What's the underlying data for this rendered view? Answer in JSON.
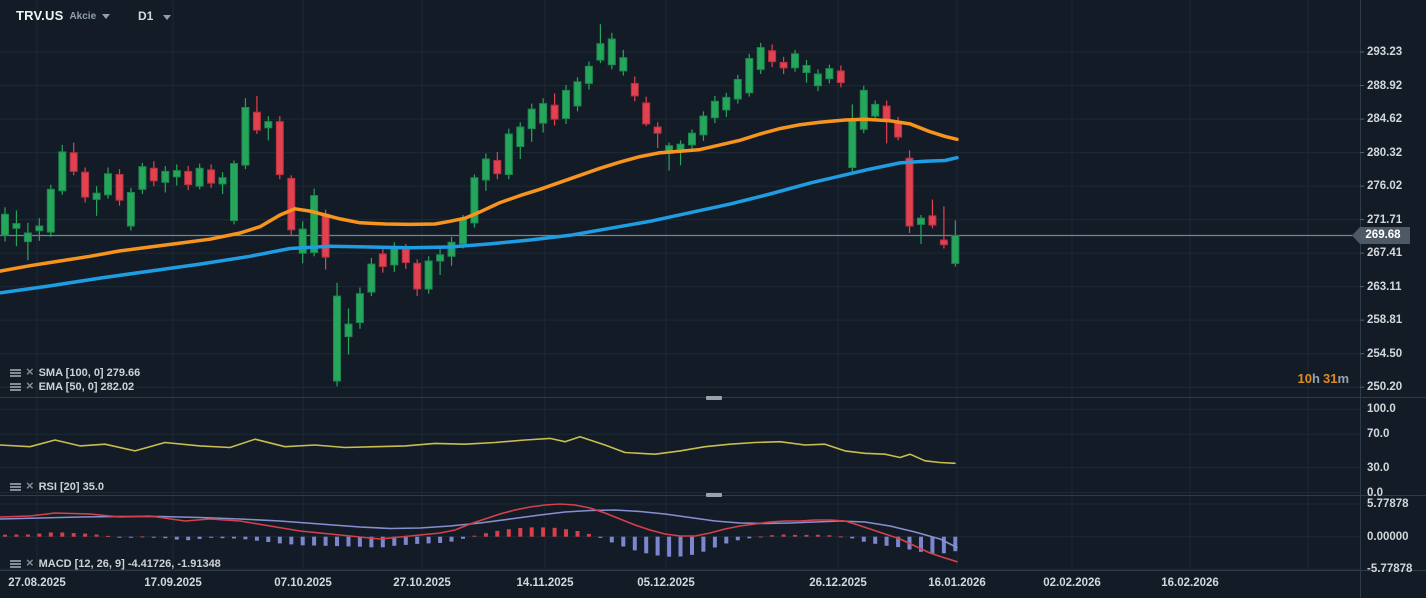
{
  "toolbar": {
    "symbol": "TRV.US",
    "instrument_type": "Akcie",
    "timeframe": "D1"
  },
  "timer": {
    "h_num": "10",
    "h_unit": "h",
    "m_num": "31",
    "m_unit": "m"
  },
  "indicators": {
    "sma": {
      "text": "SMA [100, 0] 279.66"
    },
    "ema": {
      "text": "EMA [50, 0] 282.02"
    },
    "rsi": {
      "text": "RSI [20]  35.0"
    },
    "macd": {
      "text": "MACD [12, 26, 9] -4.41726,  -1.91348"
    }
  },
  "axis": {
    "price_labels": [
      "293.23",
      "288.92",
      "284.62",
      "280.32",
      "276.02",
      "271.71",
      "267.41",
      "263.11",
      "258.81",
      "254.50",
      "250.20"
    ],
    "current_price": "269.68",
    "rsi_labels": [
      {
        "v": 100,
        "text": "100.0"
      },
      {
        "v": 70,
        "text": "70.0"
      },
      {
        "v": 30,
        "text": "30.0"
      },
      {
        "v": 0,
        "text": "0.0"
      }
    ],
    "macd_labels": [
      {
        "v": 5.77878,
        "text": "5.77878"
      },
      {
        "v": 0,
        "text": "0.00000"
      },
      {
        "v": -5.77878,
        "text": "-5.77878"
      }
    ],
    "dates": [
      "27.08.2025",
      "17.09.2025",
      "07.10.2025",
      "27.10.2025",
      "14.11.2025",
      "05.12.2025",
      "26.12.2025",
      "16.01.2026",
      "02.02.2026",
      "16.02.2026"
    ]
  },
  "colors": {
    "background": "#131c26",
    "grid": "#1d2935",
    "separator": "#2e3b48",
    "bull": "#26a65b",
    "bull_stroke": "#1b8a4f",
    "bear": "#e2414f",
    "bear_stroke": "#b5323f",
    "ema_line": "#f7941d",
    "sma_line": "#1e9de3",
    "rsi_line": "#c8bd4f",
    "macd_line": "#d6404b",
    "macd_signal": "#8690d0",
    "hist_pos": "#d6404b",
    "hist_neg": "#7b86cf",
    "price_line": "#76828c",
    "tag_bg": "#4d5a66",
    "timer_accent": "#e08a1e"
  },
  "chart_data": {
    "type": "candlestick+indicators",
    "symbol": "TRV.US",
    "timeframe": "D1",
    "current_price": 269.68,
    "panes": [
      {
        "name": "price",
        "range": [
          250.2,
          293.23
        ]
      },
      {
        "name": "rsi",
        "range": [
          0,
          100
        ],
        "gridlines": [
          100,
          70,
          30,
          0
        ]
      },
      {
        "name": "macd",
        "range": [
          -5.77878,
          5.77878
        ]
      }
    ],
    "overlays": [
      {
        "name": "EMA",
        "params": [
          50,
          0
        ],
        "value": 282.02
      },
      {
        "name": "SMA",
        "params": [
          100,
          0
        ],
        "value": 279.66
      }
    ],
    "candles_ohlc": [
      [
        269.7,
        273.3,
        268.9,
        272.4
      ],
      [
        270.6,
        272.9,
        268.3,
        271.2
      ],
      [
        268.9,
        271.3,
        266.5,
        270.0
      ],
      [
        270.3,
        271.9,
        269.0,
        270.9
      ],
      [
        270.1,
        276.2,
        269.5,
        275.6
      ],
      [
        275.4,
        281.3,
        274.9,
        280.4
      ],
      [
        280.3,
        281.6,
        277.4,
        277.9
      ],
      [
        277.8,
        278.4,
        273.9,
        274.6
      ],
      [
        274.3,
        276.0,
        272.2,
        275.1
      ],
      [
        274.9,
        278.4,
        274.4,
        277.6
      ],
      [
        277.5,
        278.2,
        273.5,
        274.2
      ],
      [
        270.9,
        275.8,
        270.3,
        275.2
      ],
      [
        275.6,
        279.0,
        275.0,
        278.5
      ],
      [
        278.3,
        279.2,
        276.0,
        276.7
      ],
      [
        276.5,
        278.6,
        275.2,
        277.9
      ],
      [
        277.2,
        278.8,
        276.1,
        278.0
      ],
      [
        277.9,
        278.6,
        275.5,
        276.2
      ],
      [
        276.0,
        278.9,
        275.6,
        278.3
      ],
      [
        278.1,
        278.8,
        275.8,
        276.4
      ],
      [
        276.3,
        277.8,
        275.0,
        277.1
      ],
      [
        271.6,
        279.3,
        271.1,
        278.9
      ],
      [
        278.7,
        287.3,
        278.2,
        286.1
      ],
      [
        285.5,
        287.6,
        282.7,
        283.2
      ],
      [
        283.5,
        285.0,
        281.9,
        284.3
      ],
      [
        284.3,
        285.0,
        276.9,
        277.5
      ],
      [
        277.0,
        277.4,
        269.6,
        270.4
      ],
      [
        267.4,
        271.5,
        266.1,
        270.5
      ],
      [
        267.5,
        275.7,
        267.0,
        274.8
      ],
      [
        272.4,
        273.0,
        265.3,
        266.9
      ],
      [
        251.0,
        263.6,
        250.3,
        261.9
      ],
      [
        256.7,
        260.3,
        254.4,
        258.3
      ],
      [
        258.5,
        263.0,
        257.7,
        262.2
      ],
      [
        262.4,
        266.8,
        261.9,
        266.0
      ],
      [
        267.3,
        268.2,
        264.9,
        265.7
      ],
      [
        265.9,
        268.8,
        265.0,
        268.0
      ],
      [
        267.9,
        268.6,
        265.4,
        266.2
      ],
      [
        266.1,
        266.6,
        261.9,
        262.8
      ],
      [
        262.8,
        267.0,
        262.2,
        266.4
      ],
      [
        266.4,
        268.0,
        264.6,
        267.2
      ],
      [
        267.0,
        269.5,
        265.8,
        268.8
      ],
      [
        268.6,
        272.3,
        268.0,
        271.9
      ],
      [
        271.3,
        277.5,
        270.7,
        277.1
      ],
      [
        276.8,
        280.2,
        275.4,
        279.5
      ],
      [
        279.3,
        280.4,
        276.9,
        277.6
      ],
      [
        277.5,
        283.4,
        276.9,
        282.7
      ],
      [
        281.1,
        284.2,
        279.5,
        283.6
      ],
      [
        283.4,
        286.6,
        281.7,
        285.9
      ],
      [
        284.1,
        287.3,
        282.9,
        286.6
      ],
      [
        286.4,
        287.9,
        283.8,
        284.6
      ],
      [
        284.7,
        289.0,
        284.0,
        288.3
      ],
      [
        286.3,
        290.0,
        285.6,
        289.4
      ],
      [
        289.2,
        292.0,
        288.4,
        291.4
      ],
      [
        292.2,
        296.8,
        291.8,
        294.3
      ],
      [
        291.6,
        295.7,
        291.0,
        294.9
      ],
      [
        290.8,
        293.5,
        290.2,
        292.5
      ],
      [
        289.2,
        290.1,
        286.9,
        287.6
      ],
      [
        286.7,
        287.5,
        283.7,
        284.0
      ],
      [
        283.6,
        284.2,
        280.9,
        282.8
      ],
      [
        280.2,
        281.6,
        278.0,
        281.2
      ],
      [
        280.7,
        281.9,
        278.7,
        281.4
      ],
      [
        281.3,
        283.3,
        280.5,
        282.8
      ],
      [
        282.6,
        285.6,
        281.8,
        285.0
      ],
      [
        284.8,
        287.6,
        284.1,
        286.9
      ],
      [
        285.8,
        288.0,
        284.9,
        287.4
      ],
      [
        287.2,
        290.3,
        286.6,
        289.7
      ],
      [
        288.0,
        293.0,
        287.5,
        292.4
      ],
      [
        291.0,
        294.4,
        290.4,
        293.8
      ],
      [
        293.4,
        294.2,
        291.3,
        292.0
      ],
      [
        291.9,
        292.6,
        290.4,
        291.2
      ],
      [
        291.2,
        293.5,
        290.7,
        293.0
      ],
      [
        290.6,
        292.2,
        289.3,
        291.5
      ],
      [
        288.9,
        291.0,
        288.2,
        290.4
      ],
      [
        289.8,
        291.6,
        289.2,
        291.1
      ],
      [
        290.8,
        291.5,
        288.7,
        289.3
      ],
      [
        278.4,
        286.5,
        277.9,
        284.6
      ],
      [
        283.3,
        288.9,
        282.8,
        288.3
      ],
      [
        285.0,
        287.0,
        284.4,
        286.5
      ],
      [
        286.3,
        287.0,
        281.5,
        284.4
      ],
      [
        284.2,
        284.9,
        281.9,
        282.3
      ],
      [
        279.6,
        280.6,
        270.0,
        270.9
      ],
      [
        271.1,
        272.3,
        268.6,
        271.9
      ],
      [
        272.2,
        274.3,
        270.6,
        271.0
      ],
      [
        269.1,
        273.4,
        268.0,
        268.5
      ],
      [
        266.1,
        271.6,
        265.7,
        269.68
      ]
    ],
    "ema50": [
      [
        0,
        265.1
      ],
      [
        30,
        265.8
      ],
      [
        60,
        266.4
      ],
      [
        90,
        267.0
      ],
      [
        120,
        267.7
      ],
      [
        150,
        268.2
      ],
      [
        180,
        268.7
      ],
      [
        210,
        269.2
      ],
      [
        240,
        270.0
      ],
      [
        260,
        270.8
      ],
      [
        280,
        272.3
      ],
      [
        295,
        273.1
      ],
      [
        310,
        272.8
      ],
      [
        325,
        272.3
      ],
      [
        340,
        271.8
      ],
      [
        360,
        271.3
      ],
      [
        385,
        271.15
      ],
      [
        410,
        271.1
      ],
      [
        435,
        271.15
      ],
      [
        450,
        271.5
      ],
      [
        465,
        271.9
      ],
      [
        480,
        272.7
      ],
      [
        500,
        273.9
      ],
      [
        520,
        274.8
      ],
      [
        540,
        275.6
      ],
      [
        560,
        276.5
      ],
      [
        580,
        277.4
      ],
      [
        600,
        278.3
      ],
      [
        620,
        279.1
      ],
      [
        640,
        279.8
      ],
      [
        660,
        280.3
      ],
      [
        680,
        280.5
      ],
      [
        700,
        280.7
      ],
      [
        720,
        281.3
      ],
      [
        740,
        281.9
      ],
      [
        760,
        282.7
      ],
      [
        780,
        283.4
      ],
      [
        800,
        283.9
      ],
      [
        820,
        284.2
      ],
      [
        845,
        284.5
      ],
      [
        865,
        284.6
      ],
      [
        890,
        284.4
      ],
      [
        910,
        284.0
      ],
      [
        930,
        283.0
      ],
      [
        945,
        282.4
      ],
      [
        957,
        282.02
      ]
    ],
    "sma100": [
      [
        0,
        262.3
      ],
      [
        50,
        263.2
      ],
      [
        100,
        264.2
      ],
      [
        150,
        265.1
      ],
      [
        200,
        266.0
      ],
      [
        250,
        267.0
      ],
      [
        290,
        268.0
      ],
      [
        330,
        268.3
      ],
      [
        370,
        268.2
      ],
      [
        410,
        268.1
      ],
      [
        450,
        268.2
      ],
      [
        490,
        268.6
      ],
      [
        530,
        269.1
      ],
      [
        570,
        269.7
      ],
      [
        610,
        270.6
      ],
      [
        650,
        271.5
      ],
      [
        690,
        272.6
      ],
      [
        730,
        273.7
      ],
      [
        770,
        275.0
      ],
      [
        810,
        276.4
      ],
      [
        840,
        277.3
      ],
      [
        870,
        278.2
      ],
      [
        900,
        279.0
      ],
      [
        925,
        279.2
      ],
      [
        945,
        279.3
      ],
      [
        957,
        279.66
      ]
    ],
    "rsi": {
      "period": 20,
      "last": 35.0,
      "points": [
        [
          0,
          57
        ],
        [
          30,
          55
        ],
        [
          55,
          63
        ],
        [
          80,
          56
        ],
        [
          105,
          58
        ],
        [
          135,
          50
        ],
        [
          165,
          60
        ],
        [
          200,
          56
        ],
        [
          230,
          54
        ],
        [
          255,
          64
        ],
        [
          285,
          55
        ],
        [
          315,
          57
        ],
        [
          345,
          54
        ],
        [
          375,
          55
        ],
        [
          405,
          56
        ],
        [
          435,
          59
        ],
        [
          465,
          58
        ],
        [
          495,
          60
        ],
        [
          525,
          63
        ],
        [
          550,
          65
        ],
        [
          565,
          61
        ],
        [
          580,
          67
        ],
        [
          605,
          57
        ],
        [
          625,
          48
        ],
        [
          655,
          46
        ],
        [
          680,
          50
        ],
        [
          705,
          55
        ],
        [
          730,
          58
        ],
        [
          755,
          60
        ],
        [
          780,
          61
        ],
        [
          805,
          57
        ],
        [
          825,
          58
        ],
        [
          845,
          50
        ],
        [
          865,
          47
        ],
        [
          885,
          46
        ],
        [
          900,
          42
        ],
        [
          910,
          46
        ],
        [
          925,
          38
        ],
        [
          940,
          36
        ],
        [
          955,
          35
        ]
      ]
    },
    "macd": {
      "params": [
        12,
        26,
        9
      ],
      "last_macd": -4.41726,
      "last_signal": -1.91348,
      "macd_points": [
        [
          0,
          3.48
        ],
        [
          30,
          3.66
        ],
        [
          55,
          4.19
        ],
        [
          90,
          4.01
        ],
        [
          120,
          3.48
        ],
        [
          150,
          3.66
        ],
        [
          185,
          2.78
        ],
        [
          210,
          3.13
        ],
        [
          240,
          2.78
        ],
        [
          270,
          1.89
        ],
        [
          300,
          1.01
        ],
        [
          330,
          0.48
        ],
        [
          360,
          -0.05
        ],
        [
          380,
          -0.41
        ],
        [
          400,
          -0.05
        ],
        [
          420,
          0.3
        ],
        [
          440,
          0.65
        ],
        [
          455,
          1.18
        ],
        [
          470,
          2.24
        ],
        [
          485,
          3.13
        ],
        [
          500,
          4.01
        ],
        [
          515,
          4.72
        ],
        [
          530,
          5.25
        ],
        [
          545,
          5.6
        ],
        [
          560,
          5.78
        ],
        [
          575,
          5.6
        ],
        [
          590,
          5.07
        ],
        [
          605,
          4.19
        ],
        [
          620,
          3.13
        ],
        [
          635,
          2.07
        ],
        [
          650,
          1.18
        ],
        [
          665,
          0.48
        ],
        [
          680,
          0.12
        ],
        [
          695,
          0.12
        ],
        [
          710,
          0.65
        ],
        [
          725,
          1.36
        ],
        [
          740,
          1.89
        ],
        [
          755,
          2.24
        ],
        [
          770,
          2.6
        ],
        [
          785,
          2.78
        ],
        [
          800,
          2.78
        ],
        [
          815,
          2.95
        ],
        [
          830,
          2.95
        ],
        [
          845,
          2.78
        ],
        [
          855,
          2.24
        ],
        [
          870,
          1.36
        ],
        [
          885,
          0.48
        ],
        [
          900,
          -0.41
        ],
        [
          915,
          -1.64
        ],
        [
          930,
          -2.88
        ],
        [
          945,
          -3.76
        ],
        [
          957,
          -4.417
        ]
      ],
      "signal_points": [
        [
          0,
          3.13
        ],
        [
          40,
          3.31
        ],
        [
          80,
          3.48
        ],
        [
          120,
          3.57
        ],
        [
          160,
          3.57
        ],
        [
          200,
          3.39
        ],
        [
          240,
          3.13
        ],
        [
          280,
          2.78
        ],
        [
          320,
          2.24
        ],
        [
          360,
          1.71
        ],
        [
          390,
          1.45
        ],
        [
          420,
          1.54
        ],
        [
          450,
          1.89
        ],
        [
          480,
          2.42
        ],
        [
          510,
          3.13
        ],
        [
          540,
          3.84
        ],
        [
          565,
          4.37
        ],
        [
          590,
          4.63
        ],
        [
          615,
          4.72
        ],
        [
          640,
          4.45
        ],
        [
          665,
          4.01
        ],
        [
          690,
          3.39
        ],
        [
          715,
          2.78
        ],
        [
          740,
          2.42
        ],
        [
          765,
          2.33
        ],
        [
          790,
          2.42
        ],
        [
          815,
          2.6
        ],
        [
          840,
          2.78
        ],
        [
          865,
          2.6
        ],
        [
          890,
          1.89
        ],
        [
          915,
          0.83
        ],
        [
          940,
          -0.41
        ],
        [
          957,
          -1.913
        ]
      ]
    }
  }
}
